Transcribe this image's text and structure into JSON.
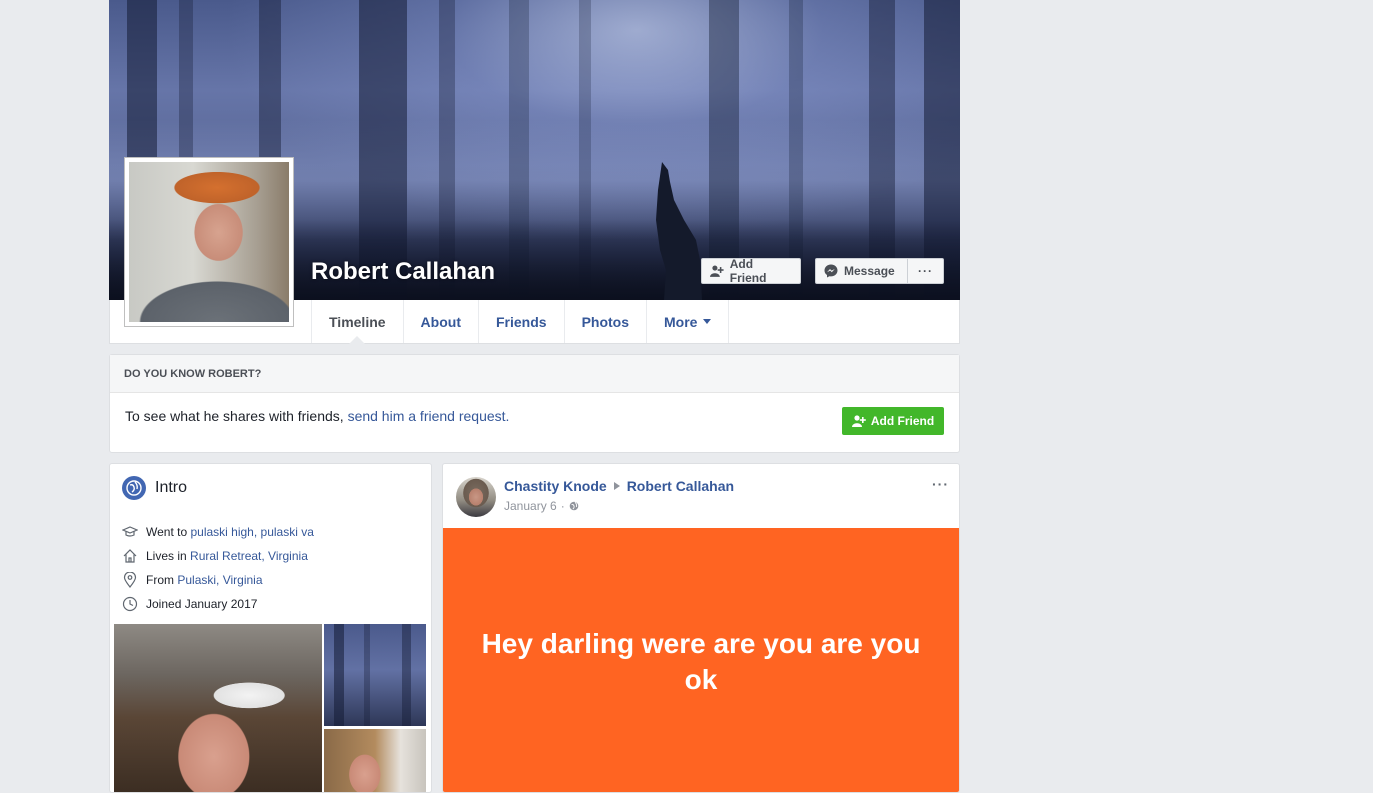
{
  "profile": {
    "name": "Robert Callahan"
  },
  "cover_actions": {
    "add_friend": "Add Friend",
    "message": "Message",
    "more": "···"
  },
  "tabs": [
    {
      "label": "Timeline"
    },
    {
      "label": "About"
    },
    {
      "label": "Friends"
    },
    {
      "label": "Photos"
    },
    {
      "label": "More"
    }
  ],
  "know_box": {
    "heading": "DO YOU KNOW ROBERT?",
    "text": "To see what he shares with friends,",
    "link": "send him a friend request.",
    "button": "Add Friend"
  },
  "intro": {
    "title": "Intro",
    "items": [
      {
        "icon": "graduation-cap-icon",
        "prefix": "Went to",
        "link": "pulaski high, pulaski va"
      },
      {
        "icon": "home-icon",
        "prefix": "Lives in",
        "link": "Rural Retreat, Virginia"
      },
      {
        "icon": "location-pin-icon",
        "prefix": "From",
        "link": "Pulaski, Virginia"
      },
      {
        "icon": "clock-icon",
        "prefix": "Joined January 2017",
        "link": ""
      }
    ]
  },
  "post": {
    "author": "Chastity Knode",
    "target": "Robert Callahan",
    "date": "January 6",
    "separator": "·",
    "privacy_icon": "globe-icon",
    "more": "···",
    "text": "Hey darling were are you are you ok",
    "background_color": "#ff6422"
  },
  "colors": {
    "link": "#365899",
    "green_button": "#42b72a",
    "page_bg": "#e9ebee"
  }
}
